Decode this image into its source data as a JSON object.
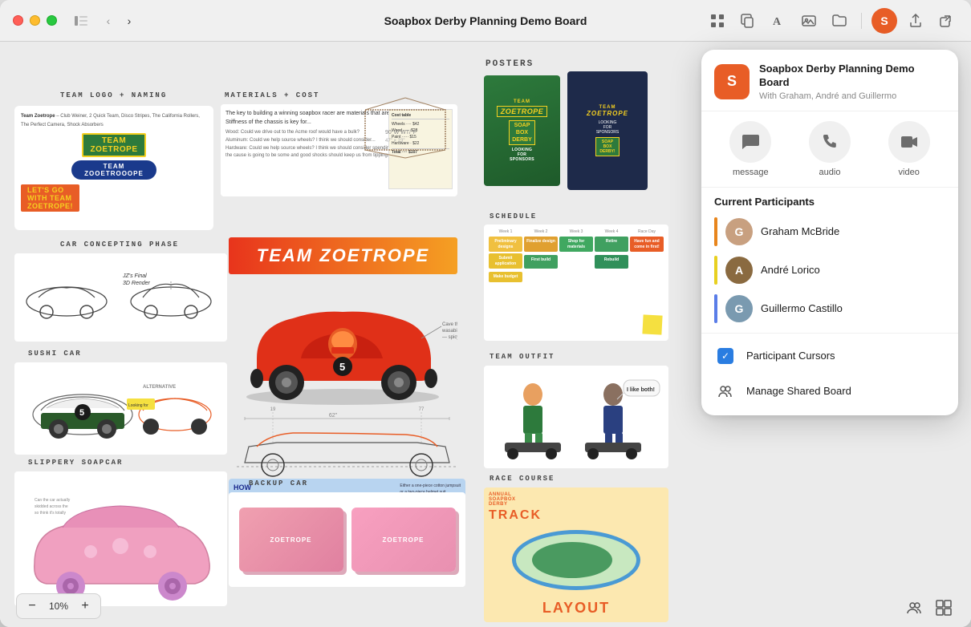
{
  "window": {
    "title": "Soapbox Derby Planning Demo Board"
  },
  "titlebar": {
    "title": "Soapbox Derby Planning Demo Board",
    "nav_back": "‹",
    "nav_forward": "›",
    "tools": {
      "grid_icon": "⊞",
      "copy_icon": "⧉",
      "text_icon": "A",
      "image_icon": "⬜",
      "folder_icon": "📁",
      "share_icon": "↑",
      "external_icon": "⬡"
    }
  },
  "zoom": {
    "minus_label": "−",
    "value": "10%",
    "plus_label": "+"
  },
  "board": {
    "sections": {
      "posters": "POSTERS",
      "materials": "MATERIALS + COST",
      "team_logo": "TEAM LOGO + NAMING",
      "car_concepting": "CAR CONCEPTING PHASE",
      "schedule": "SCHEDULE",
      "team_outfit": "TEAM OUTFIT",
      "sushi_car": "SUSHI CAR",
      "slippery_car": "SLIPPERY SOAPCAR",
      "backup_car": "BACKUP CAR",
      "race_course": "RACE COURSE",
      "big_banner": "TEAM ZOETROPE"
    },
    "team_names": [
      "Team Zoetrope",
      "Zoetrooope"
    ],
    "schedule_weeks": [
      "Week 1",
      "Week 2",
      "Week 3",
      "Week 4",
      "Race Day"
    ],
    "schedule_items": [
      {
        "label": "Preliminary designs",
        "color": "#e8aa35"
      },
      {
        "label": "Finalize design",
        "color": "#e8aa35"
      },
      {
        "label": "Shop for materials",
        "color": "#3a9a4a"
      },
      {
        "label": "Retire",
        "color": "#3a9a4a"
      },
      {
        "label": "Have fun and come in first!",
        "color": "#e85d26"
      },
      {
        "label": "Submit application",
        "color": "#e8aa35"
      },
      {
        "label": "First build",
        "color": "#3a9a4a"
      },
      {
        "label": "Rebuild",
        "color": "#3a9a4a"
      },
      {
        "label": "Make budget",
        "color": "#e8aa35"
      }
    ]
  },
  "popup": {
    "logo_letter": "S",
    "title": "Soapbox Derby Planning Demo Board",
    "subtitle": "With Graham, André and Guillermo",
    "actions": [
      {
        "id": "message",
        "label": "message",
        "icon": "💬"
      },
      {
        "id": "audio",
        "label": "audio",
        "icon": "📞"
      },
      {
        "id": "video",
        "label": "video",
        "icon": "📹"
      }
    ],
    "section_title": "Current Participants",
    "participants": [
      {
        "name": "Graham McBride",
        "indicator_color": "#e8851c",
        "avatar_color": "#c8a080",
        "initials": "G"
      },
      {
        "name": "André Lorico",
        "indicator_color": "#e8d020",
        "avatar_color": "#8a6a40",
        "initials": "A"
      },
      {
        "name": "Guillermo Castillo",
        "indicator_color": "#5a7de8",
        "avatar_color": "#7a9ab0",
        "initials": "G"
      }
    ],
    "options": [
      {
        "id": "participant-cursors",
        "label": "Participant Cursors",
        "type": "checkbox",
        "checked": true
      },
      {
        "id": "manage-shared-board",
        "label": "Manage Shared Board",
        "type": "icon",
        "icon": "👥"
      }
    ]
  }
}
